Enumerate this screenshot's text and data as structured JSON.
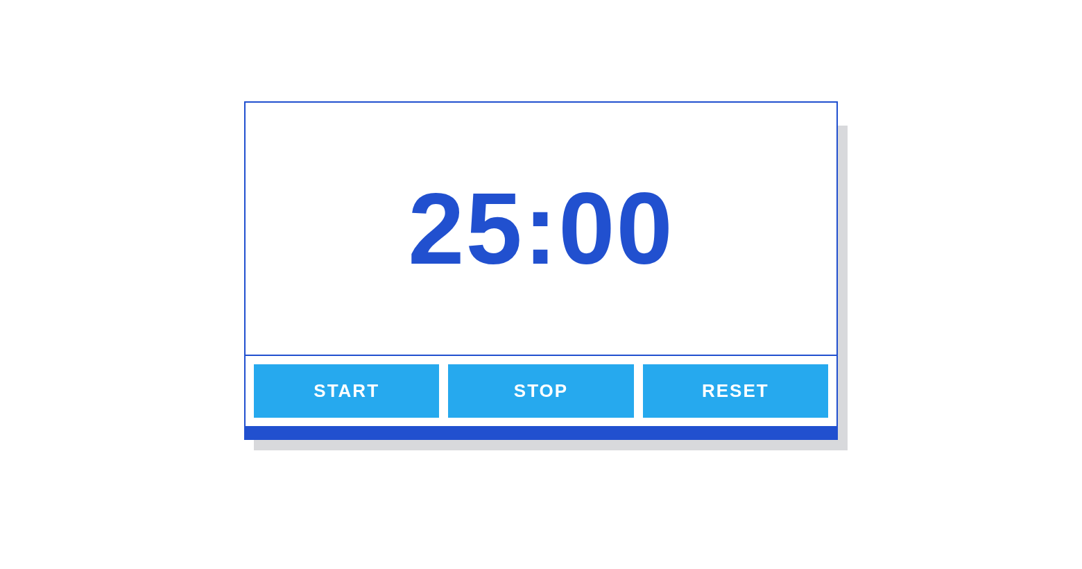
{
  "timer": {
    "display": "25:00"
  },
  "buttons": [
    "START",
    "STOP",
    "RESET"
  ]
}
